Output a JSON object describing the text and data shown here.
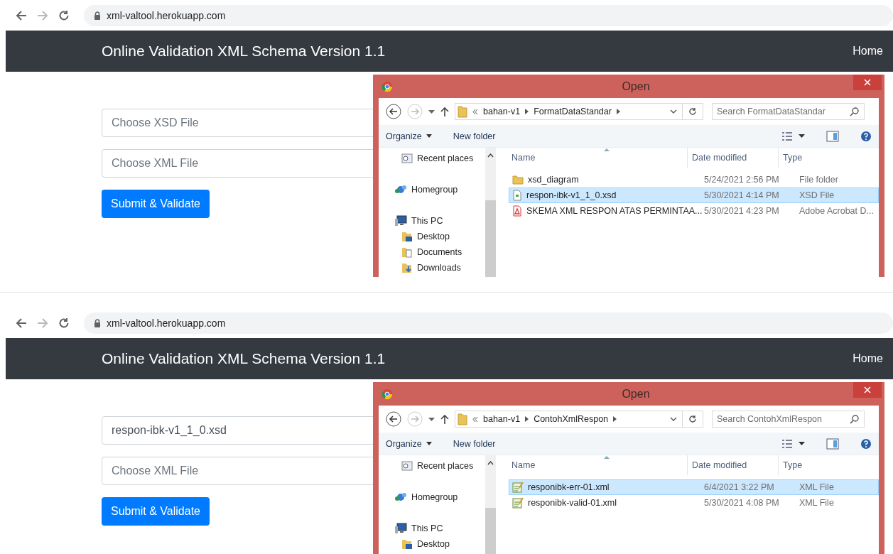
{
  "panels": [
    {
      "browser": {
        "url": "xml-valtool.herokuapp.com"
      },
      "navbar": {
        "title": "Online Validation XML Schema Version 1.1",
        "link": "Home"
      },
      "form": {
        "fields": [
          {
            "placeholder": "Choose XSD File"
          },
          {
            "placeholder": "Choose XML File"
          }
        ],
        "submit": "Submit & Validate"
      },
      "dialog": {
        "title": "Open",
        "path": [
          "bahan-v1",
          "FormatDataStandar"
        ],
        "search": {
          "placeholder": "Search FormatDataStandar"
        },
        "toolbar": {
          "organize": "Organize",
          "new_folder": "New folder"
        },
        "nav": [
          {
            "label": "Recent places",
            "kind": "sub"
          },
          {
            "label": "Homegroup",
            "kind": "group"
          },
          {
            "label": "This PC",
            "kind": "pc",
            "children": [
              {
                "label": "Desktop",
                "kind": "desktop"
              },
              {
                "label": "Documents",
                "kind": "docs"
              },
              {
                "label": "Downloads",
                "kind": "downloads"
              }
            ]
          }
        ],
        "columns": [
          "Name",
          "Date modified",
          "Type"
        ],
        "files": [
          {
            "name": "xsd_diagram",
            "date": "5/24/2021 2:56 PM",
            "type": "File folder",
            "kind": "folder",
            "selected": false
          },
          {
            "name": "respon-ibk-v1_1_0.xsd",
            "date": "5/30/2021 4:14 PM",
            "type": "XSD File",
            "kind": "doc",
            "selected": true
          },
          {
            "name": "SKEMA XML RESPON ATAS PERMINTAA...",
            "date": "5/30/2021 4:23 PM",
            "type": "Adobe Acrobat D...",
            "kind": "pdf",
            "selected": false
          }
        ]
      }
    },
    {
      "browser": {
        "url": "xml-valtool.herokuapp.com"
      },
      "navbar": {
        "title": "Online Validation XML Schema Version 1.1",
        "link": "Home"
      },
      "form": {
        "fields": [
          {
            "value": "respon-ibk-v1_1_0.xsd"
          },
          {
            "placeholder": "Choose XML File"
          }
        ],
        "submit": "Submit & Validate"
      },
      "dialog": {
        "title": "Open",
        "path": [
          "bahan-v1",
          "ContohXmlRespon"
        ],
        "search": {
          "placeholder": "Search ContohXmlRespon"
        },
        "toolbar": {
          "organize": "Organize",
          "new_folder": "New folder"
        },
        "nav": [
          {
            "label": "Recent places",
            "kind": "sub"
          },
          {
            "label": "Homegroup",
            "kind": "group"
          },
          {
            "label": "This PC",
            "kind": "pc",
            "children": [
              {
                "label": "Desktop",
                "kind": "desktop"
              }
            ]
          }
        ],
        "columns": [
          "Name",
          "Date modified",
          "Type"
        ],
        "files": [
          {
            "name": "responibk-err-01.xml",
            "date": "6/4/2021 3:22 PM",
            "type": "XML File",
            "kind": "xml",
            "selected": true
          },
          {
            "name": "responibk-valid-01.xml",
            "date": "5/30/2021 4:08 PM",
            "type": "XML File",
            "kind": "xml",
            "selected": false
          }
        ]
      }
    }
  ]
}
